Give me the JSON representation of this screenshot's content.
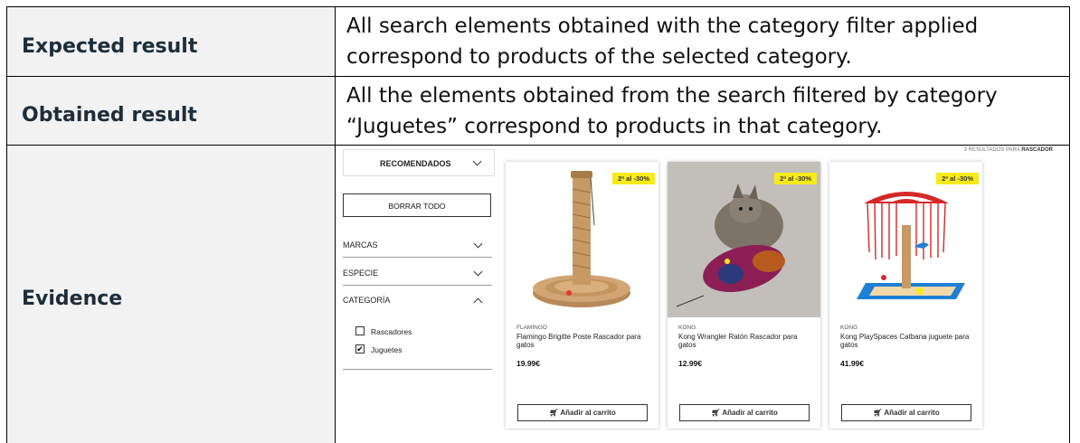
{
  "rows": {
    "expected": {
      "label": "Expected result",
      "line1": "All search elements obtained with the category filter applied",
      "line2": "correspond to products of the selected category."
    },
    "obtained": {
      "label": "Obtained result",
      "line1": "All the elements obtained from the search filtered by category",
      "line2": "“Juguetes” correspond to products in that category."
    },
    "evidence": {
      "label": "Evidence"
    }
  },
  "evidence_screen": {
    "results_prefix": "3 RESULTADOS PARA",
    "results_query": "RASCADOR",
    "sort_label": "RECOMENDADOS",
    "clear_all": "BORRAR TODO",
    "filters": [
      {
        "label": "MARCAS",
        "expanded": false
      },
      {
        "label": "ESPECIE",
        "expanded": false
      },
      {
        "label": "CATEGORÍA",
        "expanded": true
      }
    ],
    "category_options": [
      {
        "label": "Rascadores",
        "checked": false
      },
      {
        "label": "Juguetes",
        "checked": true
      }
    ],
    "products": [
      {
        "badge": "2ª al -30%",
        "brand": "FLAMINGO",
        "name": "Flamingo Brigitte Poste Rascador para gatos",
        "price": "19.99€",
        "cart": "Añadir al carrito"
      },
      {
        "badge": "2ª al -30%",
        "brand": "KONG",
        "name": "Kong Wrangler Ratón Rascador para gatos",
        "price": "12.99€",
        "cart": "Añadir al carrito"
      },
      {
        "badge": "2ª al -30%",
        "brand": "KONG",
        "name": "Kong PlaySpaces Catbana juguete para gatos",
        "price": "41.99€",
        "cart": "Añadir al carrito"
      }
    ],
    "colors": {
      "badge": "#f6ea1b",
      "label_cell": "#f2f2f2"
    },
    "icons": {
      "cart": "cart-icon",
      "sort": "chevron-down-icon",
      "expanded": "chevron-up-icon",
      "checked": "checkbox-checked-icon"
    }
  }
}
